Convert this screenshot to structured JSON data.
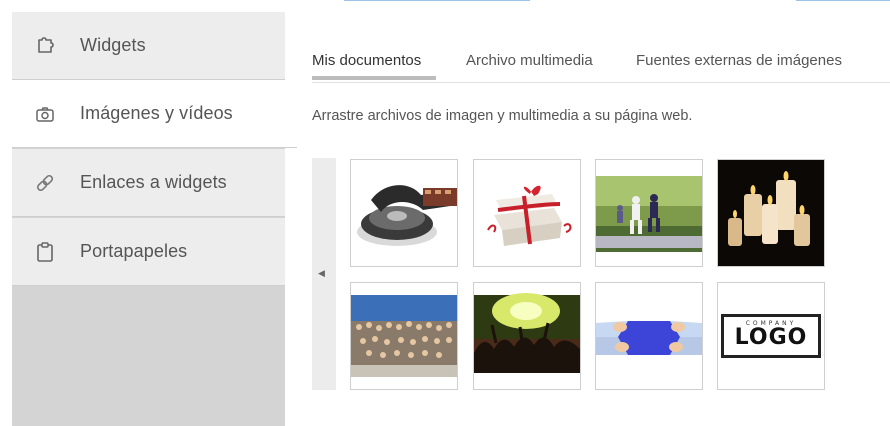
{
  "sidebar": {
    "items": [
      {
        "label": "Widgets",
        "icon": "puzzle-icon"
      },
      {
        "label": "Imágenes y vídeos",
        "icon": "camera-icon"
      },
      {
        "label": "Enlaces a widgets",
        "icon": "link-icon"
      },
      {
        "label": "Portapapeles",
        "icon": "clipboard-icon"
      }
    ],
    "active_index": 1
  },
  "tabs": [
    {
      "label": "Mis documentos",
      "active": true
    },
    {
      "label": "Archivo multimedia",
      "active": false
    },
    {
      "label": "Fuentes externas de imágenes",
      "active": false
    }
  ],
  "hint": "Arrastre archivos de imagen y multimedia a su página web.",
  "gallery": {
    "scroll_arrow": "◀",
    "logo": {
      "small_text": "COMPANY",
      "big_text": "LOGO"
    }
  },
  "colors": {
    "sidebar_bg": "#d4d4d4",
    "item_bg": "#ededed",
    "active_item_bg": "#ffffff",
    "tab_underline": "#bcbcbc",
    "top_accent": "#9ec3e6"
  }
}
